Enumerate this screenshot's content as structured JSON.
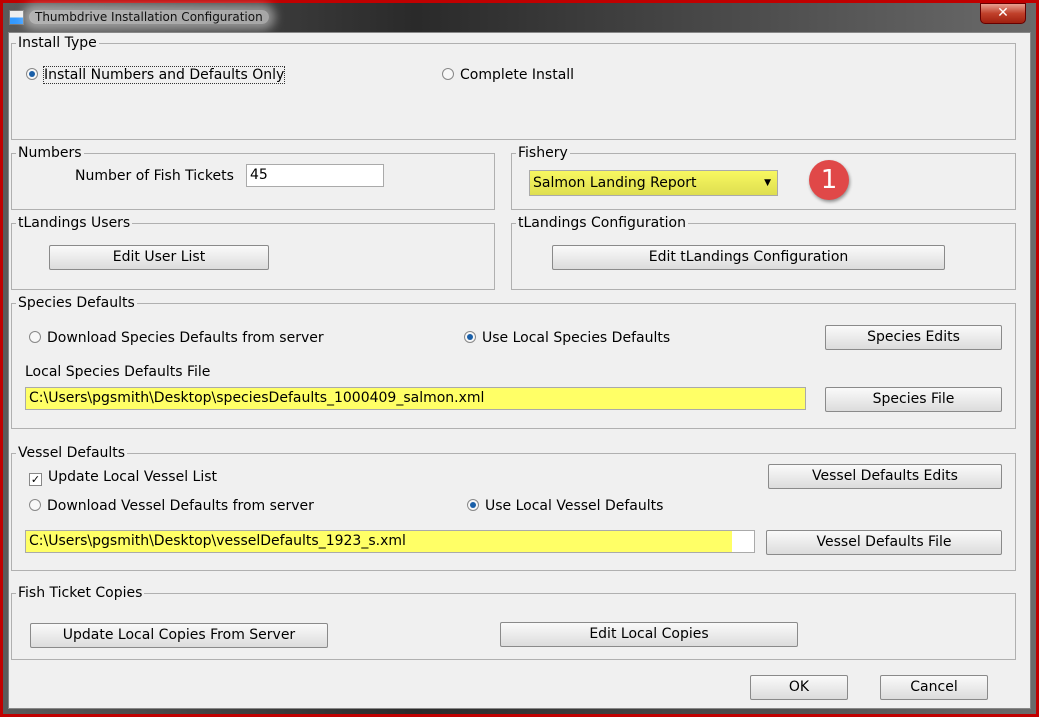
{
  "window": {
    "title": "Thumbdrive Installation Configuration",
    "close": "✕"
  },
  "install_type": {
    "legend": "Install Type",
    "option1": "Install Numbers and Defaults Only",
    "option2": "Complete Install"
  },
  "numbers": {
    "legend": "Numbers",
    "label": "Number of Fish Tickets",
    "value": "45"
  },
  "fishery": {
    "legend": "Fishery",
    "selected": "Salmon Landing Report",
    "badge": "1"
  },
  "users": {
    "legend": "tLandings Users",
    "button": "Edit User List"
  },
  "config": {
    "legend": "tLandings Configuration",
    "button": "Edit tLandings Configuration"
  },
  "species": {
    "legend": "Species Defaults",
    "radio1": "Download Species Defaults from server",
    "radio2": "Use Local Species Defaults",
    "edits_button": "Species Edits",
    "file_label": "Local Species Defaults File",
    "file": "C:\\Users\\pgsmith\\Desktop\\speciesDefaults_1000409_salmon.xml",
    "file_button": "Species File"
  },
  "vessel": {
    "legend": "Vessel Defaults",
    "checkbox": "Update Local Vessel List",
    "radio1": "Download Vessel Defaults from server",
    "radio2": "Use Local Vessel Defaults",
    "edits_button": "Vessel Defaults Edits",
    "file": "C:\\Users\\pgsmith\\Desktop\\vesselDefaults_1923_s.xml",
    "file_button": "Vessel Defaults File"
  },
  "copies": {
    "legend": "Fish Ticket Copies",
    "update_button": "Update Local Copies From Server",
    "edit_button": "Edit Local Copies"
  },
  "footer": {
    "ok": "OK",
    "cancel": "Cancel"
  }
}
